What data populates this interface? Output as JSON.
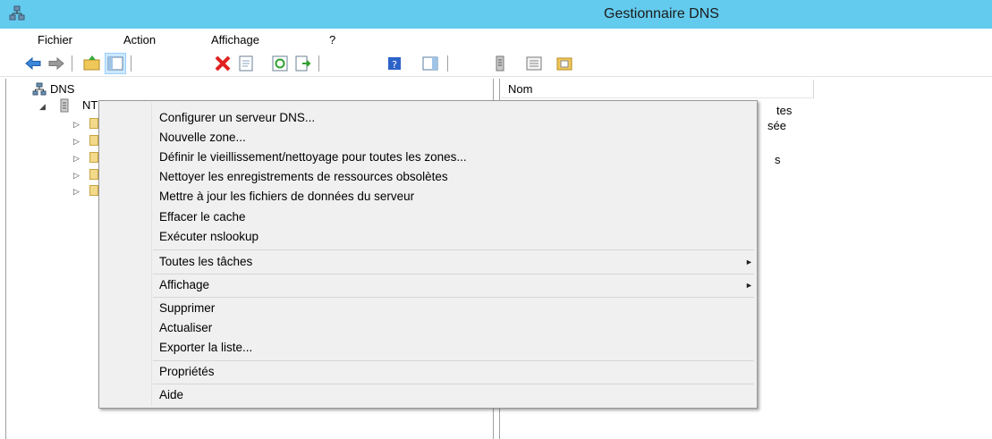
{
  "window": {
    "title": "Gestionnaire DNS"
  },
  "menubar": [
    "Fichier",
    "Action",
    "Affichage",
    "?"
  ],
  "toolbar": {
    "icons": [
      "back-arrow-icon",
      "forward-arrow-icon",
      "up-folder-icon",
      "show-hide-tree-icon",
      "delete-icon",
      "properties-icon",
      "refresh-icon",
      "export-list-icon",
      "help-icon",
      "show-hide-action-pane-icon",
      "server-icon",
      "zone-icon",
      "record-icon"
    ]
  },
  "tree": {
    "root_label": "DNS",
    "server_label": "NTIC",
    "collapse_glyph": "◢",
    "expand_glyph": "▷"
  },
  "list": {
    "column_name": "Nom",
    "row_fragments": [
      "tes",
      "sée",
      "s"
    ]
  },
  "context_menu": {
    "items": [
      "Configurer un serveur DNS...",
      "Nouvelle zone...",
      "Définir le vieillissement/nettoyage pour toutes les zones...",
      "Nettoyer les enregistrements de ressources obsolètes",
      "Mettre à jour les fichiers de données du serveur",
      "Effacer le cache",
      "Exécuter nslookup",
      "Toutes les tâches",
      "Affichage",
      "Supprimer",
      "Actualiser",
      "Exporter la liste...",
      "Propriétés",
      "Aide"
    ],
    "submenu_arrow": "►"
  },
  "colors": {
    "titlebar": "#63cbee",
    "menu_bg": "#f0f0f0",
    "toolbar_selected": "#cce8ff"
  }
}
